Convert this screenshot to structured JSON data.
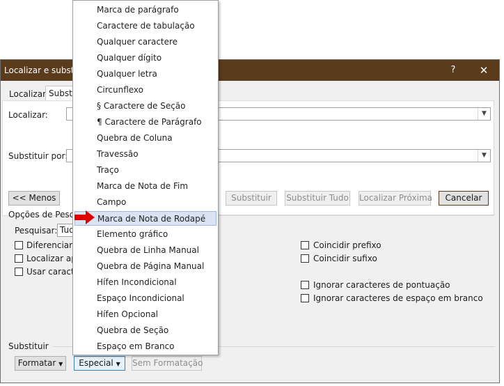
{
  "dialog": {
    "title": "Localizar e substituir",
    "help": "?",
    "close": "✕",
    "tabs": [
      "Localizar",
      "Substituir"
    ],
    "localizar_label": "Localizar:",
    "substituir_label": "Substituir por:",
    "buttons": {
      "menos": "<< Menos",
      "substituir": "Substituir",
      "substituir_tudo": "Substituir Tudo",
      "localizar_proxima": "Localizar Próxima",
      "cancelar": "Cancelar"
    },
    "options_title": "Opções de Pesquisa",
    "pesquisar_label": "Pesquisar:",
    "pesquisar_value": "Tudo",
    "left_options": [
      "Diferenciar maiúsculas e minúsculas",
      "Localizar apenas palavras inteiras",
      "Usar caracteres curinga"
    ],
    "right_options": [
      "Coincidir prefixo",
      "Coincidir sufixo",
      "Ignorar caracteres de pontuação",
      "Ignorar caracteres de espaço em branco"
    ],
    "substituir_section": "Substituir",
    "bottom_buttons": {
      "formatar": "Formatar",
      "especial": "Especial",
      "sem_formatacao": "Sem Formatação"
    }
  },
  "menu": {
    "items": [
      "Marca de parágrafo",
      "Caractere de tabulação",
      "Qualquer caractere",
      "Qualquer dígito",
      "Qualquer letra",
      "Circunflexo",
      "§ Caractere de Seção",
      "¶ Caractere de Parágrafo",
      "Quebra de Coluna",
      "Travessão",
      "Traço",
      "Marca de Nota de Fim",
      "Campo",
      "Marca de Nota de Rodapé",
      "Elemento gráfico",
      "Quebra de Linha Manual",
      "Quebra de Página Manual",
      "Hífen Incondicional",
      "Espaço Incondicional",
      "Hífen Opcional",
      "Quebra de Seção",
      "Espaço em Branco"
    ],
    "highlighted_index": 13
  },
  "colors": {
    "titlebar": "#5a3b1c",
    "highlight": "#dae3f2",
    "arrow": "#e00000"
  }
}
